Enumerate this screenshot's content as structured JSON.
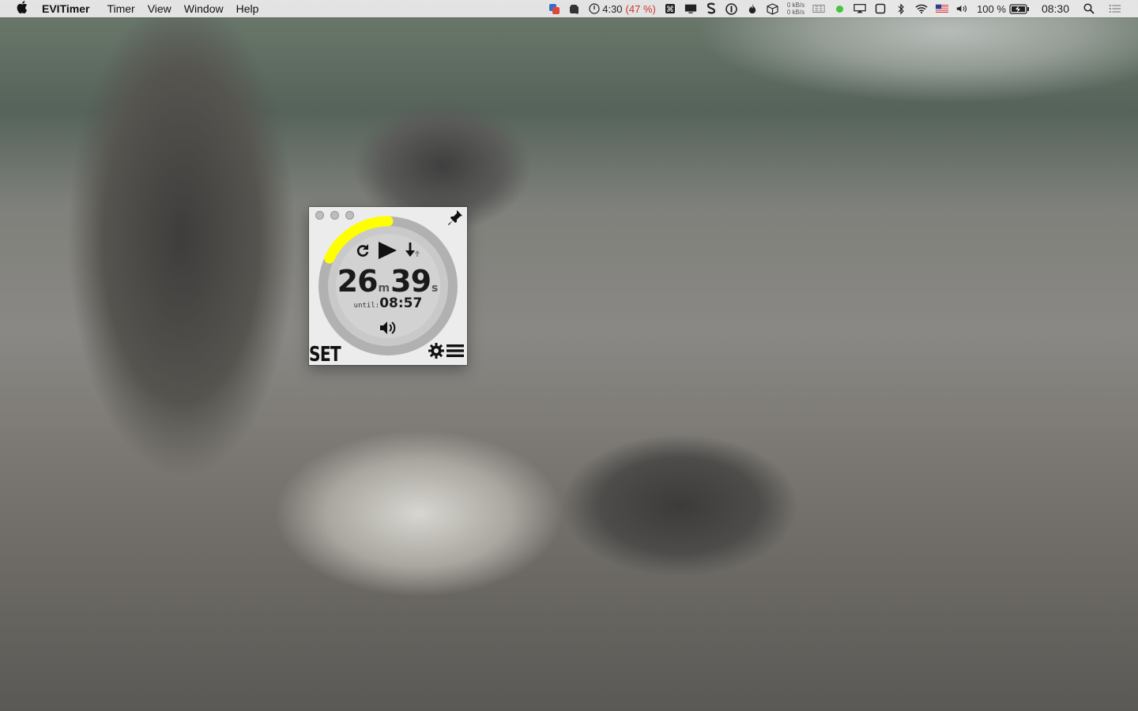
{
  "menubar": {
    "app_name": "EVITimer",
    "menus": [
      "Timer",
      "View",
      "Window",
      "Help"
    ],
    "status": {
      "battery_time": "4:30",
      "battery_percent_paren": "(47 %)",
      "net_up": "0 kB/s",
      "net_down": "0 kB/s",
      "battery_level": "100 %",
      "clock": "08:30"
    }
  },
  "timer": {
    "minutes": "26",
    "minutes_unit": "m",
    "seconds": "39",
    "seconds_unit": "s",
    "until_label": "until:",
    "until_time": "08:57",
    "progress_fraction": 0.18,
    "set_label": "SET",
    "colors": {
      "progress": "#ffff00",
      "ring": "#b4b4b4",
      "face": "#c8c8c8"
    }
  },
  "icons": [
    "apple-icon",
    "repeat-icon",
    "play-icon",
    "countdown-icon",
    "sound-icon",
    "gear-icon",
    "menu-icon",
    "pin-icon"
  ]
}
